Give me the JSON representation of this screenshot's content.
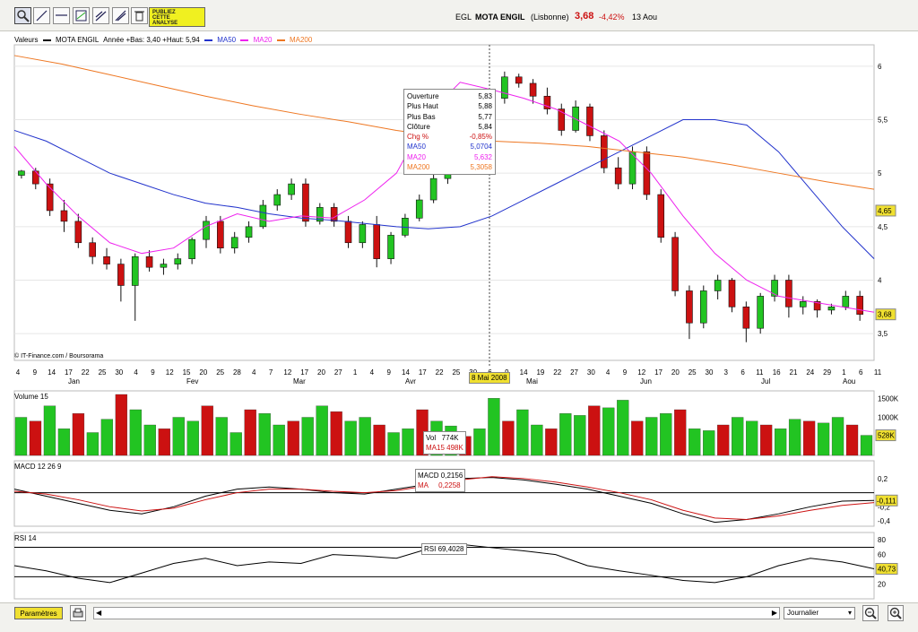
{
  "toolbar": {
    "icons": [
      "zoom-icon",
      "line-icon",
      "horizontal-line-icon",
      "chart-icon",
      "trend-icon",
      "pen-icon",
      "trash-icon"
    ],
    "promo_line1": "PUBLIEZ",
    "promo_line2": "CETTE",
    "promo_line3": "ANALYSE"
  },
  "header": {
    "ticker": "EGL",
    "name": "MOTA ENGIL",
    "market": "(Lisbonne)",
    "price": "3,68",
    "change": "-4,42%",
    "date": "13 Aou"
  },
  "legend": {
    "prefix": "Valeurs",
    "series_name": "MOTA ENGIL",
    "range": "Année +Bas: 3,40 +Haut: 5,94",
    "ma50": "MA50",
    "ma20": "MA20",
    "ma200": "MA200"
  },
  "colors": {
    "up": "#22c422",
    "down": "#cc1111",
    "ma50": "#2233cc",
    "ma20": "#ee22ee",
    "ma200": "#ee7722",
    "accent": "#f0e030"
  },
  "tooltip": {
    "rows": [
      {
        "label": "Ouverture",
        "value": "5,83",
        "color": "#000"
      },
      {
        "label": "Plus Haut",
        "value": "5,88",
        "color": "#000"
      },
      {
        "label": "Plus Bas",
        "value": "5,77",
        "color": "#000"
      },
      {
        "label": "Clôture",
        "value": "5,84",
        "color": "#000"
      },
      {
        "label": "Chg %",
        "value": "-0,85%",
        "color": "#cc1111"
      },
      {
        "label": "MA50",
        "value": "5,0704",
        "color": "#2233cc"
      },
      {
        "label": "MA20",
        "value": "5,632",
        "color": "#ee22ee"
      },
      {
        "label": "MA200",
        "value": "5,3058",
        "color": "#ee7722"
      }
    ],
    "cursor_date": "8 Mai 2008"
  },
  "copyright": "© IT-Finance.com / Boursorama",
  "price_axis": {
    "ticks": [
      "6",
      "5,5",
      "5",
      "4,5",
      "4",
      "3,5"
    ],
    "last": "3,68",
    "level": "4,65"
  },
  "x_axis": {
    "days": [
      "4",
      "9",
      "14",
      "17",
      "22",
      "25",
      "30",
      "4",
      "9",
      "12",
      "15",
      "20",
      "25",
      "28",
      "4",
      "7",
      "12",
      "17",
      "20",
      "27",
      "1",
      "4",
      "9",
      "14",
      "17",
      "22",
      "25",
      "30",
      "6",
      "9",
      "14",
      "19",
      "22",
      "27",
      "30",
      "4",
      "9",
      "12",
      "17",
      "20",
      "25",
      "30",
      "3",
      "6",
      "11",
      "16",
      "21",
      "24",
      "29",
      "1",
      "6",
      "11"
    ],
    "months": [
      "Jan",
      "Fev",
      "Mar",
      "Avr",
      "Mai",
      "Jun",
      "Jul",
      "Aou"
    ]
  },
  "volume": {
    "title": "Volume 15",
    "ticks": [
      "1500K",
      "1000K",
      "500K"
    ],
    "last": "528K",
    "vol_label": "Vol",
    "vol_value": "774K",
    "ma_label": "MA15",
    "ma_value": "498K"
  },
  "macd": {
    "title": "MACD 12 26 9",
    "ticks": [
      "0,2",
      "-0,2",
      "-0,4"
    ],
    "last": "-0,111",
    "macd_label": "MACD",
    "macd_value": "0,2156",
    "ma_label": "MA",
    "ma_value": "0,2258"
  },
  "rsi": {
    "title": "RSI 14",
    "ticks": [
      "80",
      "60",
      "20"
    ],
    "last": "40,73",
    "label": "RSI",
    "value": "69,4028"
  },
  "bottom": {
    "params": "Paramètres",
    "period": "Journalier"
  },
  "chart_data": {
    "type": "candlestick",
    "title": "MOTA ENGIL",
    "ylim": [
      3.25,
      6.2
    ],
    "series": [
      {
        "name": "MA50",
        "values": [
          5.4,
          5.3,
          5.15,
          5.0,
          4.9,
          4.8,
          4.72,
          4.68,
          4.62,
          4.58,
          4.56,
          4.53,
          4.5,
          4.48,
          4.5,
          4.6,
          4.75,
          4.9,
          5.05,
          5.2,
          5.35,
          5.5,
          5.5,
          5.45,
          5.2,
          4.85,
          4.5,
          4.2
        ]
      },
      {
        "name": "MA20",
        "values": [
          5.25,
          4.9,
          4.6,
          4.35,
          4.25,
          4.3,
          4.5,
          4.62,
          4.55,
          4.6,
          4.58,
          4.75,
          5.0,
          5.55,
          5.85,
          5.78,
          5.7,
          5.6,
          5.45,
          5.3,
          5.0,
          4.6,
          4.25,
          4.0,
          3.85,
          3.8,
          3.75,
          3.7
        ]
      },
      {
        "name": "MA200",
        "values": [
          6.1,
          6.02,
          5.92,
          5.82,
          5.72,
          5.63,
          5.55,
          5.48,
          5.4,
          5.34,
          5.3,
          5.28,
          5.25,
          5.2,
          5.15,
          5.08,
          5.0,
          4.92,
          4.85
        ]
      }
    ],
    "candles": [
      [
        4.98,
        5.03,
        4.95,
        5.02
      ],
      [
        5.02,
        5.05,
        4.85,
        4.9
      ],
      [
        4.9,
        4.95,
        4.6,
        4.65
      ],
      [
        4.65,
        4.75,
        4.45,
        4.55
      ],
      [
        4.55,
        4.62,
        4.3,
        4.35
      ],
      [
        4.35,
        4.4,
        4.15,
        4.22
      ],
      [
        4.22,
        4.3,
        4.1,
        4.15
      ],
      [
        4.15,
        4.2,
        3.8,
        3.95
      ],
      [
        3.95,
        4.25,
        3.62,
        4.22
      ],
      [
        4.22,
        4.28,
        4.08,
        4.12
      ],
      [
        4.12,
        4.2,
        4.05,
        4.15
      ],
      [
        4.15,
        4.25,
        4.1,
        4.2
      ],
      [
        4.2,
        4.4,
        4.15,
        4.38
      ],
      [
        4.38,
        4.6,
        4.3,
        4.55
      ],
      [
        4.55,
        4.6,
        4.25,
        4.3
      ],
      [
        4.3,
        4.45,
        4.25,
        4.4
      ],
      [
        4.4,
        4.55,
        4.35,
        4.5
      ],
      [
        4.5,
        4.75,
        4.48,
        4.7
      ],
      [
        4.7,
        4.85,
        4.65,
        4.8
      ],
      [
        4.8,
        4.95,
        4.75,
        4.9
      ],
      [
        4.9,
        4.95,
        4.5,
        4.55
      ],
      [
        4.55,
        4.72,
        4.52,
        4.68
      ],
      [
        4.68,
        4.72,
        4.5,
        4.55
      ],
      [
        4.55,
        4.6,
        4.3,
        4.35
      ],
      [
        4.35,
        4.55,
        4.3,
        4.52
      ],
      [
        4.52,
        4.6,
        4.12,
        4.2
      ],
      [
        4.2,
        4.45,
        4.15,
        4.42
      ],
      [
        4.42,
        4.62,
        4.4,
        4.58
      ],
      [
        4.58,
        4.8,
        4.55,
        4.75
      ],
      [
        4.75,
        5.0,
        4.72,
        4.95
      ],
      [
        4.95,
        5.15,
        4.9,
        5.1
      ],
      [
        5.1,
        5.35,
        5.05,
        5.3
      ],
      [
        5.3,
        5.55,
        5.25,
        5.5
      ],
      [
        5.5,
        5.75,
        5.45,
        5.7
      ],
      [
        5.7,
        5.95,
        5.65,
        5.9
      ],
      [
        5.9,
        5.93,
        5.8,
        5.84
      ],
      [
        5.84,
        5.88,
        5.65,
        5.72
      ],
      [
        5.72,
        5.8,
        5.55,
        5.6
      ],
      [
        5.6,
        5.65,
        5.35,
        5.4
      ],
      [
        5.4,
        5.68,
        5.38,
        5.62
      ],
      [
        5.62,
        5.65,
        5.3,
        5.35
      ],
      [
        5.35,
        5.4,
        5.0,
        5.05
      ],
      [
        5.05,
        5.15,
        4.85,
        4.9
      ],
      [
        4.9,
        5.25,
        4.85,
        5.2
      ],
      [
        5.2,
        5.25,
        4.75,
        4.8
      ],
      [
        4.8,
        4.85,
        4.35,
        4.4
      ],
      [
        4.4,
        4.45,
        3.85,
        3.9
      ],
      [
        3.9,
        3.95,
        3.45,
        3.6
      ],
      [
        3.6,
        3.95,
        3.55,
        3.9
      ],
      [
        3.9,
        4.05,
        3.82,
        4.0
      ],
      [
        4.0,
        4.02,
        3.7,
        3.75
      ],
      [
        3.75,
        3.8,
        3.42,
        3.55
      ],
      [
        3.55,
        3.88,
        3.5,
        3.85
      ],
      [
        3.85,
        4.05,
        3.8,
        4.0
      ],
      [
        4.0,
        4.05,
        3.65,
        3.75
      ],
      [
        3.75,
        3.85,
        3.68,
        3.8
      ],
      [
        3.8,
        3.82,
        3.65,
        3.72
      ],
      [
        3.72,
        3.78,
        3.68,
        3.75
      ],
      [
        3.75,
        3.9,
        3.72,
        3.85
      ],
      [
        3.85,
        3.9,
        3.62,
        3.68
      ]
    ],
    "volume_k": [
      1000,
      900,
      1300,
      700,
      1100,
      600,
      950,
      1600,
      1200,
      800,
      700,
      1000,
      900,
      1300,
      1000,
      600,
      1200,
      1100,
      800,
      900,
      1000,
      1300,
      1150,
      900,
      1000,
      800,
      600,
      700,
      1200,
      900,
      774,
      500,
      700,
      1500,
      900,
      1200,
      800,
      700,
      1100,
      1050,
      1300,
      1250,
      1450,
      900,
      1000,
      1100,
      1200,
      700,
      650,
      800,
      1000,
      900,
      800,
      700,
      950,
      900,
      850,
      1000,
      800,
      528
    ],
    "macd": [
      0.05,
      -0.05,
      -0.15,
      -0.25,
      -0.3,
      -0.2,
      -0.05,
      0.05,
      0.08,
      0.05,
      0.0,
      -0.02,
      0.05,
      0.12,
      0.2,
      0.2156,
      0.18,
      0.12,
      0.05,
      -0.05,
      -0.15,
      -0.3,
      -0.42,
      -0.38,
      -0.3,
      -0.2,
      -0.12,
      -0.111
    ],
    "macd_signal": [
      0.02,
      -0.02,
      -0.1,
      -0.2,
      -0.26,
      -0.22,
      -0.1,
      0.0,
      0.05,
      0.05,
      0.02,
      0.0,
      0.03,
      0.1,
      0.18,
      0.2258,
      0.2,
      0.15,
      0.08,
      0.0,
      -0.1,
      -0.25,
      -0.36,
      -0.38,
      -0.33,
      -0.25,
      -0.18,
      -0.14
    ],
    "rsi": [
      45,
      38,
      28,
      22,
      35,
      48,
      55,
      45,
      50,
      48,
      60,
      58,
      55,
      68,
      74,
      69.4028,
      65,
      60,
      45,
      38,
      32,
      25,
      22,
      30,
      45,
      55,
      50,
      40.73
    ]
  }
}
